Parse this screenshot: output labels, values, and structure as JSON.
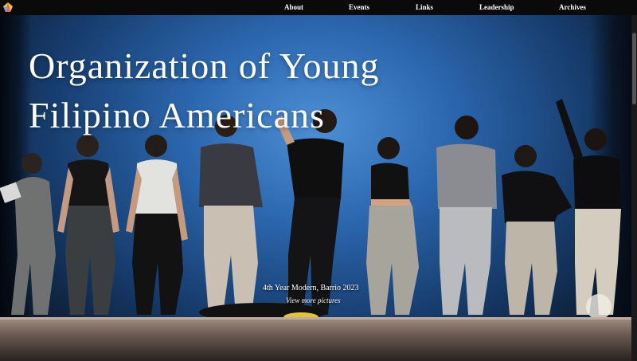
{
  "nav": {
    "items": [
      {
        "label": "About"
      },
      {
        "label": "Events"
      },
      {
        "label": "Links"
      },
      {
        "label": "Leadership"
      },
      {
        "label": "Archives"
      }
    ]
  },
  "hero": {
    "title_line1": "Organization of Young",
    "title_line2": "Filipino Americans",
    "caption": "4th Year Modern, Barrio 2023",
    "link_text": "View more pictures"
  },
  "colors": {
    "topbar": "#0a0a0a",
    "backdrop_blue": "#2b66ad",
    "text": "#ffffff"
  },
  "icons": {
    "logo": "oyfa-logo-icon"
  }
}
